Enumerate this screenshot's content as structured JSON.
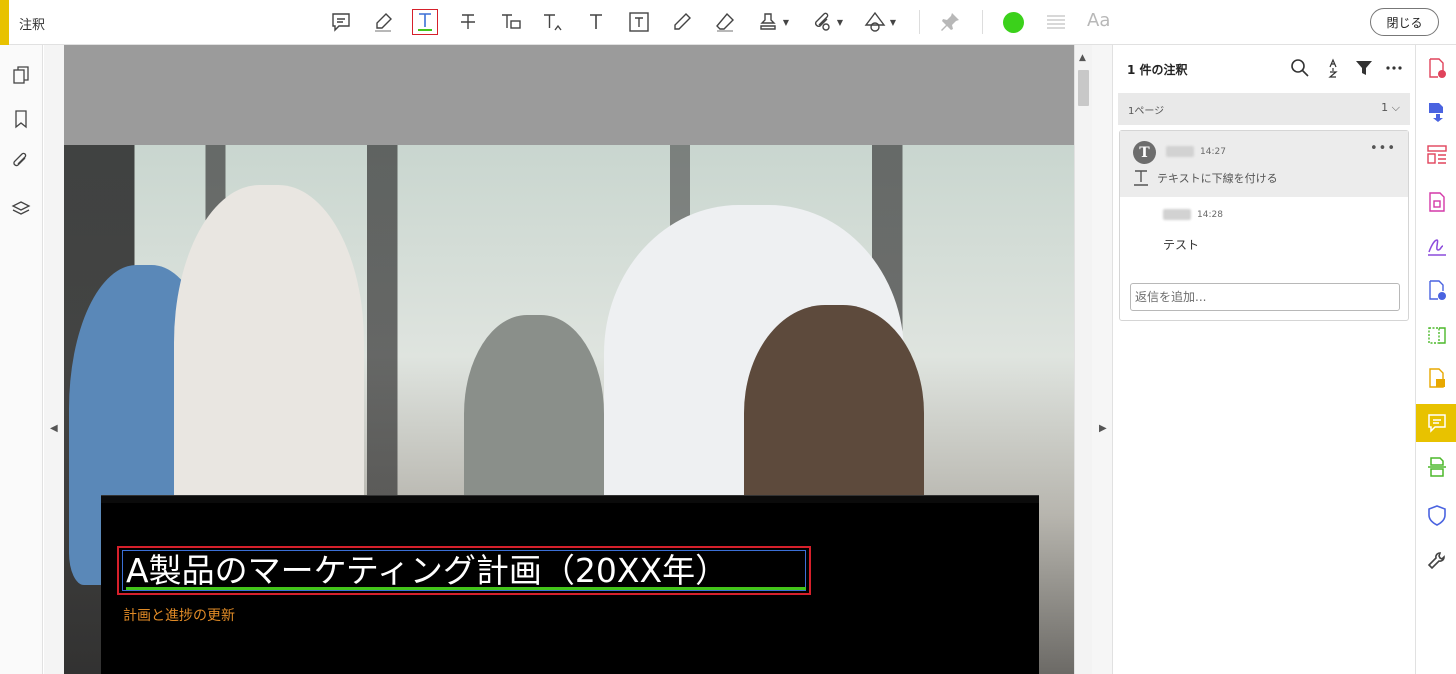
{
  "toolbar": {
    "title": "注釈",
    "close_label": "閉じる",
    "font_label": "Aa",
    "tools": [
      {
        "name": "comment-tool",
        "icon": "sticky-note-icon"
      },
      {
        "name": "highlight-tool",
        "icon": "highlighter-icon"
      },
      {
        "name": "underline-text-tool",
        "icon": "underline-t-icon",
        "active": true
      },
      {
        "name": "strikethrough-tool",
        "icon": "strikethrough-t-icon"
      },
      {
        "name": "replace-text-tool",
        "icon": "replace-text-icon"
      },
      {
        "name": "insert-text-tool",
        "icon": "insert-text-icon"
      },
      {
        "name": "add-text-tool",
        "icon": "text-t-icon"
      },
      {
        "name": "textbox-tool",
        "icon": "textbox-icon"
      },
      {
        "name": "pencil-tool",
        "icon": "pencil-icon"
      },
      {
        "name": "eraser-tool",
        "icon": "eraser-icon"
      },
      {
        "name": "stamp-tool",
        "icon": "stamp-icon"
      },
      {
        "name": "attach-tool",
        "icon": "paperclip-icon"
      },
      {
        "name": "shapes-tool",
        "icon": "shapes-icon"
      },
      {
        "name": "pin-tool",
        "icon": "pin-icon"
      }
    ],
    "color": "#3bd11b"
  },
  "document": {
    "headline": "A製品のマーケティング計画（20XX年）",
    "subtitle": "計画と進捗の更新"
  },
  "panel": {
    "title": "1 件の注釈",
    "page_group": {
      "label": "1ページ",
      "count": "1"
    },
    "comment": {
      "time": "14:27",
      "type_label": "テキストに下線を付ける",
      "reply": {
        "time": "14:28",
        "text": "テスト"
      },
      "reply_placeholder": "返信を追加..."
    }
  },
  "colors": {
    "accent": "#e8c200",
    "selection": "#d6202b",
    "underline": "#43c41a",
    "subtitle": "#e08a26"
  }
}
